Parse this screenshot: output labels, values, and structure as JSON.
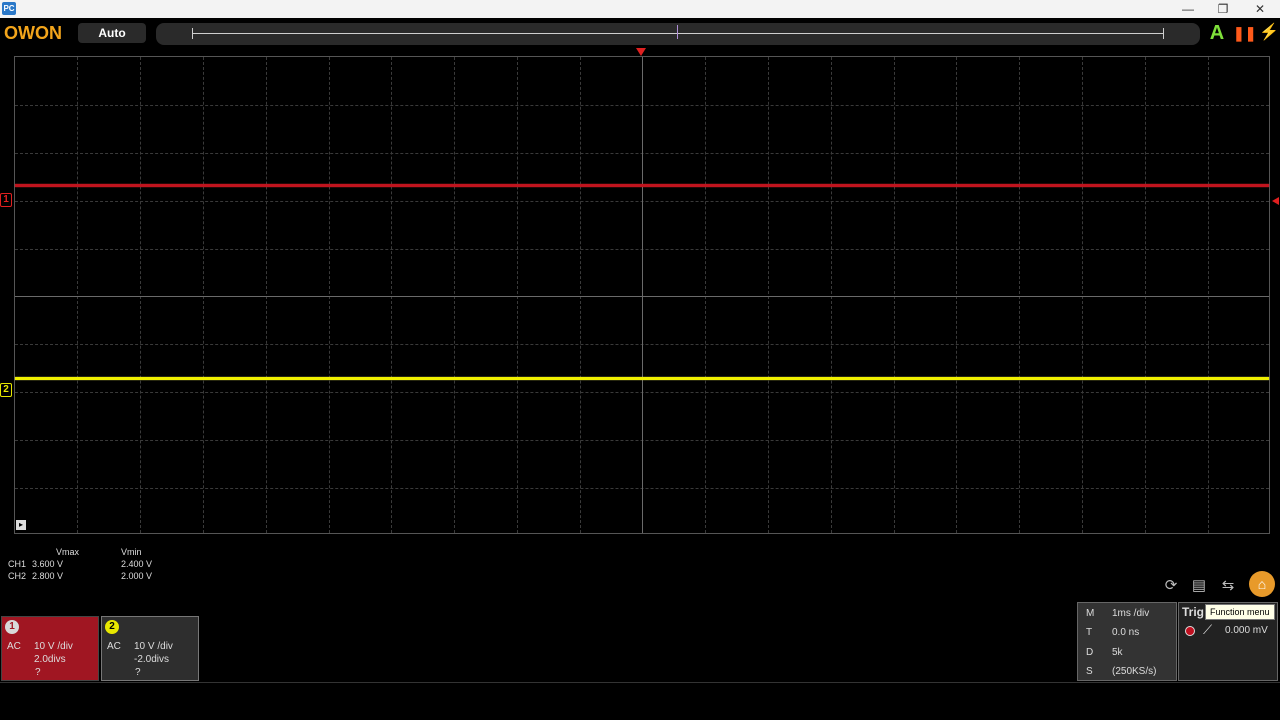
{
  "titlebar": {
    "app_icon_text": "PC",
    "minimize": "—",
    "restore": "❐",
    "close": "✕"
  },
  "toolbar": {
    "brand": "OWON",
    "mode": "Auto",
    "auto_icon": "A",
    "run_icon": "❚❚",
    "trigger_icon": "⚡"
  },
  "scope": {
    "ch1_marker": "1",
    "ch2_marker": "2",
    "colors": {
      "ch1": "#c0141e",
      "ch2": "#f0f000",
      "grid": "#3a3a3a"
    }
  },
  "measurements": {
    "headers": [
      "Vmax",
      "Vmin"
    ],
    "rows": [
      {
        "ch": "CH1",
        "vmax": "3.600 V",
        "vmin": "2.400 V"
      },
      {
        "ch": "CH2",
        "vmax": "2.800 V",
        "vmin": "2.000 V"
      }
    ]
  },
  "channels": [
    {
      "num": "1",
      "coupling": "AC",
      "vdiv": "10 V /div",
      "offset": "2.0divs",
      "probe": "?"
    },
    {
      "num": "2",
      "coupling": "AC",
      "vdiv": "10 V /div",
      "offset": "-2.0divs",
      "probe": "?"
    }
  ],
  "icons": {
    "autoset": "⟳",
    "save": "▤",
    "layout": "⇆",
    "home": "⌂"
  },
  "timebase": {
    "rows": [
      {
        "key": "M",
        "value": "1ms /div"
      },
      {
        "key": "T",
        "value": "0.0 ns"
      },
      {
        "key": "D",
        "value": "5k"
      },
      {
        "key": "S",
        "value": "(250KS/s)"
      }
    ]
  },
  "trigger": {
    "label": "Trig",
    "slope": "⟋",
    "level": "0.000 mV"
  },
  "tooltip": "Function menu"
}
